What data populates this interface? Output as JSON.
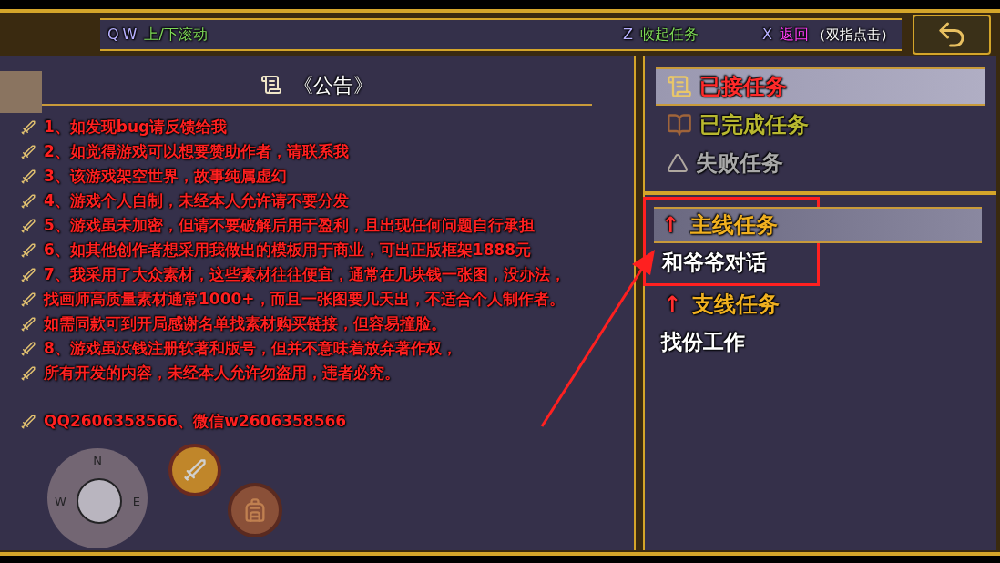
{
  "controls_bar": [
    {
      "keys": [
        "Q",
        "W"
      ],
      "label": "上/下滚动",
      "kind": "scroll"
    },
    {
      "keys": [
        "Z"
      ],
      "label": "收起任务",
      "kind": "collapse"
    },
    {
      "keys": [
        "X"
      ],
      "label": "返回",
      "note": "（双指点击）",
      "kind": "back"
    }
  ],
  "notice": {
    "title": "《公告》",
    "lines": [
      "1、如发现bug请反馈给我",
      "2、如觉得游戏可以想要赞助作者，请联系我",
      "3、该游戏架空世界，故事纯属虚幻",
      "4、游戏个人自制，未经本人允许请不要分发",
      "5、游戏虽未加密，但请不要破解后用于盈利，且出现任何问题自行承担",
      "6、如其他创作者想采用我做出的模板用于商业，可出正版框架1888元",
      "7、我采用了大众素材，这些素材往往便宜，通常在几块钱一张图，没办法，",
      "找画师高质量素材通常1000+，而且一张图要几天出，不适合个人制作者。",
      "如需同款可到开局感谢名单找素材购买链接，但容易撞脸。",
      "8、游戏虽没钱注册软著和版号，但并不意味着放弃著作权，",
      "所有开发的内容，未经本人允许勿盗用，违者必究。",
      "QQ2606358566、微信w2606358566"
    ]
  },
  "compass": {
    "labels": [
      "N",
      "W",
      "E"
    ]
  },
  "categories": [
    {
      "label": "已接任务",
      "kind": "accepted",
      "selected": true
    },
    {
      "label": "已完成任务",
      "kind": "completed",
      "selected": false
    },
    {
      "label": "失败任务",
      "kind": "failed",
      "selected": false
    }
  ],
  "quest_groups": [
    {
      "marker": "↑",
      "label": "主线任务",
      "selected": true,
      "quests": [
        {
          "label": "和爷爷对话"
        }
      ]
    },
    {
      "marker": "↑",
      "label": "支线任务",
      "selected": false,
      "quests": [
        {
          "label": "找份工作"
        }
      ]
    }
  ]
}
